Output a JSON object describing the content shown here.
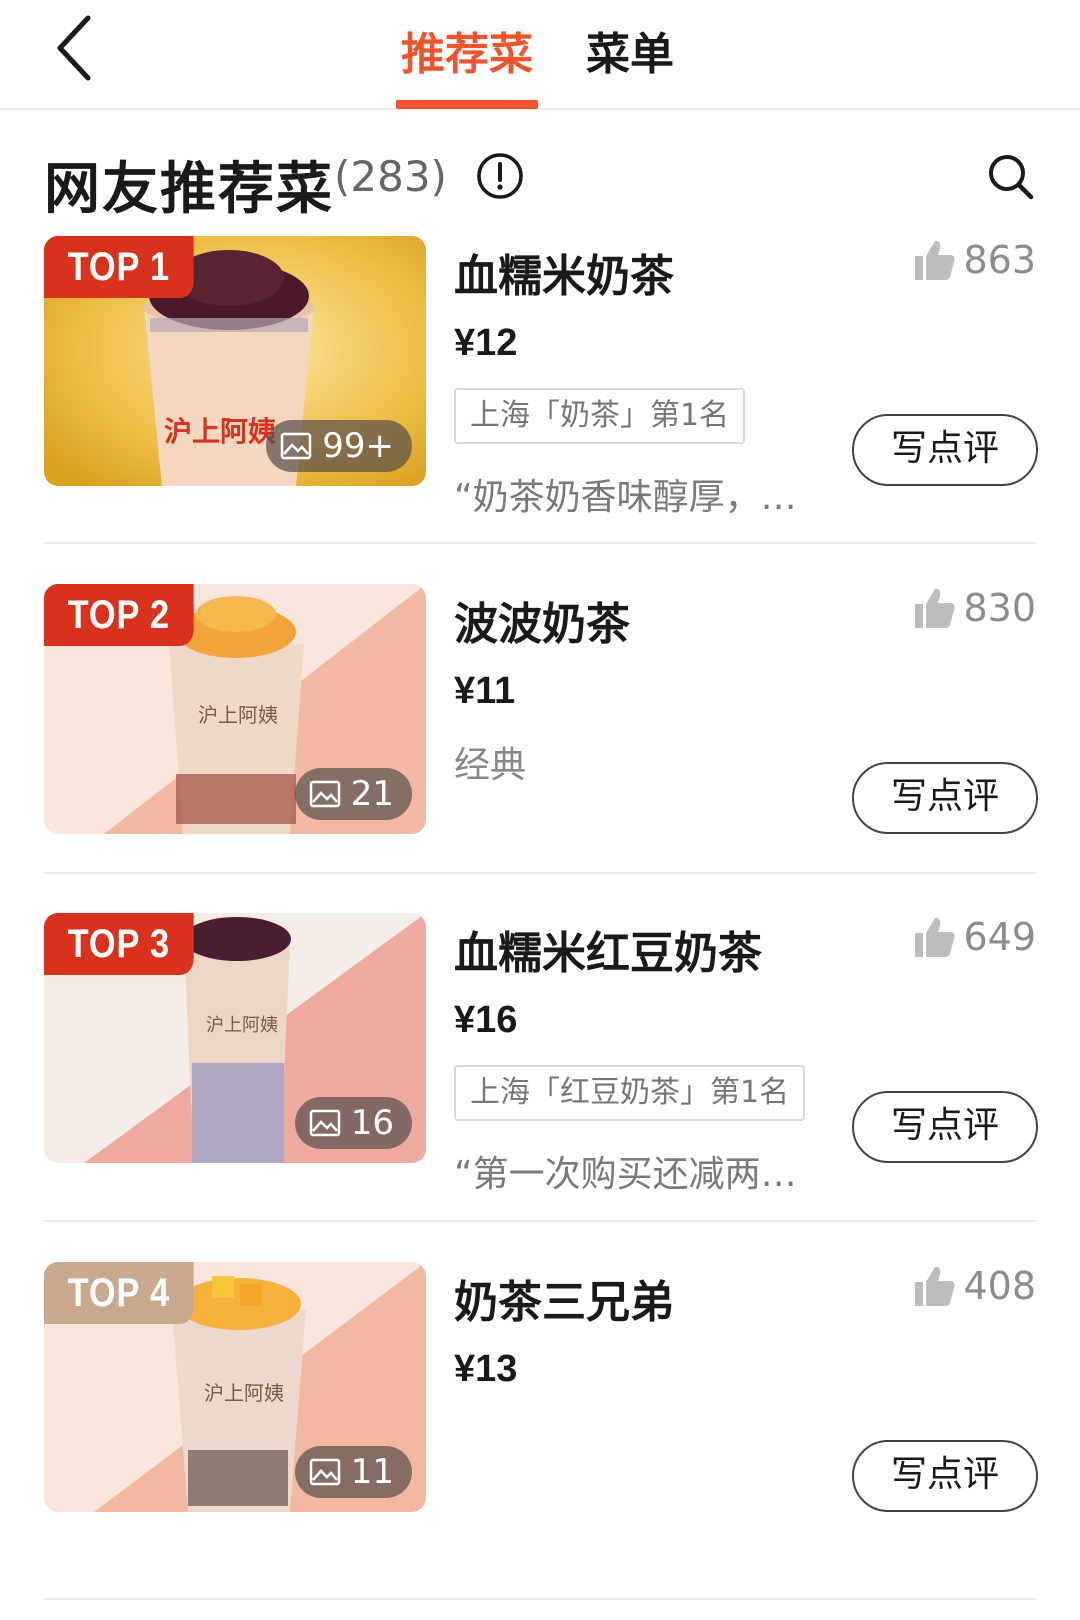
{
  "nav": {
    "tabs": [
      {
        "label": "推荐菜",
        "active": true
      },
      {
        "label": "菜单",
        "active": false
      }
    ],
    "accent_color": "#f0542c"
  },
  "section": {
    "title": "网友推荐菜",
    "count": "(283)"
  },
  "dishes": [
    {
      "rank": "TOP 1",
      "name": "血糯米奶茶",
      "price": "¥12",
      "likes": "863",
      "tag": "上海「奶茶」第1名",
      "quote": "“奶茶奶香味醇厚，…",
      "photos": "99+",
      "review_label": "写点评",
      "rank_color": "#d8321c"
    },
    {
      "rank": "TOP 2",
      "name": "波波奶茶",
      "price": "¥11",
      "likes": "830",
      "tag": "经典",
      "photos": "21",
      "review_label": "写点评",
      "rank_color": "#d8321c"
    },
    {
      "rank": "TOP 3",
      "name": "血糯米红豆奶茶",
      "price": "¥16",
      "likes": "649",
      "tag": "上海「红豆奶茶」第1名",
      "quote": "“第一次购买还减两…",
      "photos": "16",
      "review_label": "写点评",
      "rank_color": "#d8321c"
    },
    {
      "rank": "TOP 4",
      "name": "奶茶三兄弟",
      "price": "¥13",
      "likes": "408",
      "photos": "11",
      "review_label": "写点评",
      "rank_color": "#c9a98d"
    }
  ],
  "icons": {
    "back": "chevron-left-icon",
    "info": "info-circle-icon",
    "search": "search-icon",
    "like": "thumbs-up-icon",
    "photo": "image-icon"
  }
}
